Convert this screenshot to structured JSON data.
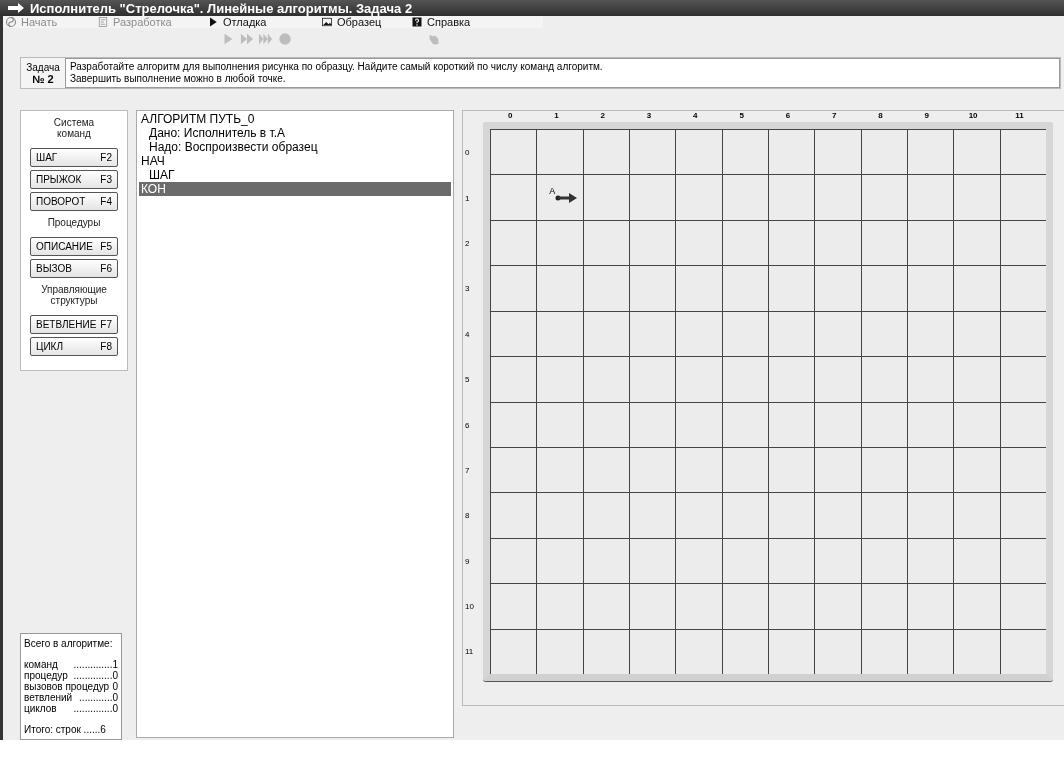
{
  "window": {
    "title": "Исполнитель \"Стрелочка\".  Линейные алгоритмы.  Задача  2"
  },
  "menu": [
    {
      "label": "Начать",
      "disabled": true
    },
    {
      "label": "Разработка",
      "disabled": true
    },
    {
      "label": "Отладка",
      "disabled": false
    },
    {
      "label": "Образец",
      "disabled": false
    },
    {
      "label": "Справка",
      "disabled": false
    }
  ],
  "toolbar": [
    {
      "disabled": true
    },
    {
      "disabled": true
    },
    {
      "disabled": true
    },
    {
      "disabled": true
    },
    {
      "disabled": true
    }
  ],
  "task": {
    "label": "Задача",
    "number": "№ 2",
    "text": "Разработайте алгоритм для выполнения рисунка по образцу. Найдите самый короткий по числу команд алгоритм.\nЗавершить выполнение можно в любой точке."
  },
  "commands": [
    {
      "kind": "heading",
      "label": "Система команд"
    },
    {
      "kind": "button",
      "label": "ШАГ",
      "key": "F2"
    },
    {
      "kind": "button",
      "label": "ПРЫЖОК",
      "key": "F3"
    },
    {
      "kind": "button",
      "label": "ПОВОРОТ",
      "key": "F4"
    },
    {
      "kind": "heading",
      "label": "Процедуры"
    },
    {
      "kind": "button",
      "label": "ОПИСАНИЕ",
      "key": "F5"
    },
    {
      "kind": "button",
      "label": "ВЫЗОВ",
      "key": "F6"
    },
    {
      "kind": "heading",
      "label": "Управляющие структуры"
    },
    {
      "kind": "button",
      "label": "ВЕТВЛЕНИЕ",
      "key": "F7"
    },
    {
      "kind": "button",
      "label": "ЦИКЛ",
      "key": "F8"
    }
  ],
  "stats": {
    "title": "Всего в алгоритме:",
    "rows": [
      {
        "label": "команд",
        "dots": "..............",
        "value": "1"
      },
      {
        "label": "процедур",
        "dots": "..............",
        "value": "0"
      },
      {
        "label": "вызовов процедур",
        "dots": "",
        "value": "0"
      },
      {
        "label": "ветвлений",
        "dots": "............",
        "value": "0"
      },
      {
        "label": "циклов",
        "dots": "..............",
        "value": "0"
      }
    ],
    "total": "Итого:  строк  ......6"
  },
  "program": [
    {
      "text": "АЛГОРИТМ ПУТЬ_0",
      "indent": false,
      "selected": false
    },
    {
      "text": "Дано: Исполнитель в т.А",
      "indent": true,
      "selected": false
    },
    {
      "text": "Надо: Воспроизвести образец",
      "indent": true,
      "selected": false
    },
    {
      "text": "НАЧ",
      "indent": false,
      "selected": false
    },
    {
      "text": "ШАГ",
      "indent": true,
      "selected": false
    },
    {
      "text": "КОН",
      "indent": false,
      "selected": true
    }
  ],
  "grid": {
    "columns": [
      "0",
      "1",
      "2",
      "3",
      "4",
      "5",
      "6",
      "7",
      "8",
      "9",
      "10",
      "11"
    ],
    "rows": [
      "0",
      "1",
      "2",
      "3",
      "4",
      "5",
      "6",
      "7",
      "8",
      "9",
      "10",
      "11"
    ],
    "executor": {
      "label": "A"
    }
  }
}
